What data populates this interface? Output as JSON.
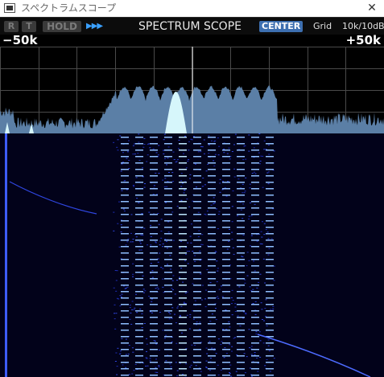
{
  "window": {
    "title": "スペクトラムスコープ",
    "close_glyph": "✕"
  },
  "toolbar": {
    "r_label": "R",
    "t_label": "T",
    "hold_label": "HOLD",
    "speed_glyph": "▶▶▶",
    "scope_title": "SPECTRUM SCOPE",
    "mode": "CENTER",
    "grid_label": "Grid",
    "scale": "10k/10dB"
  },
  "scope": {
    "span_low": "−50k",
    "span_high": "+50k"
  },
  "colors": {
    "accent": "#3d6fb0",
    "spectrum_fill": "#5b7fa6",
    "spectrum_highlight": "#d6f6fb",
    "waterfall_background": "#02021a",
    "waterfall_trace": "#3d5cff"
  },
  "icons": {
    "app": "app-icon",
    "close": "close-icon",
    "speed": "speed-icon"
  }
}
